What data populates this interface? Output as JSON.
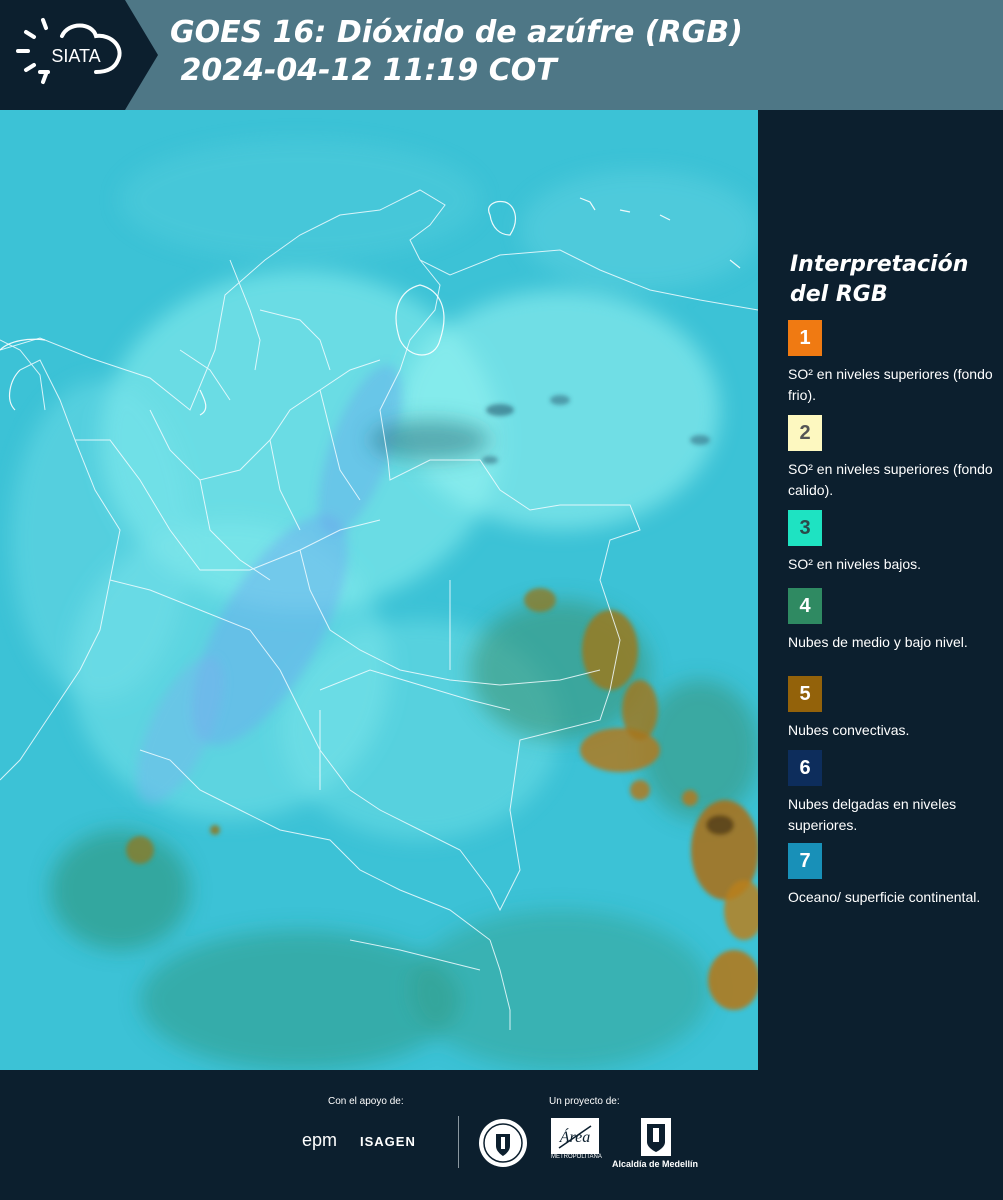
{
  "header": {
    "logo_text": "SIATA",
    "title_line1": "GOES 16: Dióxido de azúfre (RGB)",
    "title_line2": " 2024-04-12 11:19 COT"
  },
  "legend": {
    "title": "Interpretación del RGB",
    "items": [
      {
        "num": "1",
        "color": "#f07a12",
        "num_color": "#ffffff",
        "text": "SO² en niveles superiores (fondo frio)."
      },
      {
        "num": "2",
        "color": "#fdf8c0",
        "num_color": "#555555",
        "text": "SO² en niveles superiores (fondo calido)."
      },
      {
        "num": "3",
        "color": "#1ee3c2",
        "num_color": "#2b4a4a",
        "text": "SO² en niveles bajos."
      },
      {
        "num": "4",
        "color": "#2f8a62",
        "num_color": "#ffffff",
        "text": "Nubes de medio y bajo nivel."
      },
      {
        "num": "5",
        "color": "#93620a",
        "num_color": "#ffffff",
        "text": "Nubes convectivas."
      },
      {
        "num": "6",
        "color": "#0d2d5c",
        "num_color": "#ffffff",
        "text": "Nubes delgadas en niveles superiores."
      },
      {
        "num": "7",
        "color": "#1890b8",
        "num_color": "#ffffff",
        "text": "Oceano/ superficie continental."
      }
    ]
  },
  "footer": {
    "support_label": "Con el apoyo de:",
    "project_label": "Un proyecto de:",
    "epm": "epm",
    "isagen": "ISAGEN",
    "amva_top": "Área",
    "amva_bottom": "METROPOLITANA",
    "alcaldia": "Alcaldía de Medellín"
  },
  "colors": {
    "header_bg": "#4e7786",
    "panel_bg": "#0c1f2e",
    "map_base": "#3fc4d8"
  }
}
